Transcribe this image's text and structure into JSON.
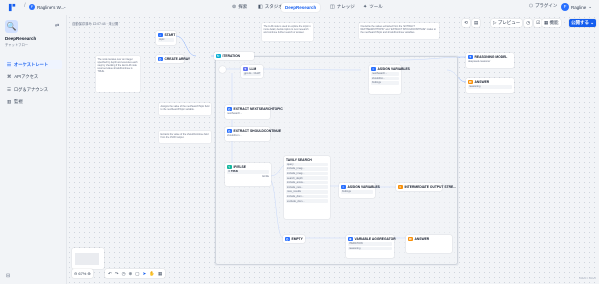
{
  "header": {
    "workspace_initial": "F",
    "workspace_name": "Ragline's W...",
    "nav": [
      {
        "label": "探索",
        "icon": "⊚"
      },
      {
        "label": "スタジオ",
        "icon": "◧"
      },
      {
        "label": "DeepResearch",
        "icon": ""
      },
      {
        "label": "ナレッジ",
        "icon": "◫"
      },
      {
        "label": "ツール",
        "icon": "✦"
      }
    ],
    "plugins": "プラグイン",
    "user_initial": "F",
    "user_name": "Ragline"
  },
  "sidebar": {
    "app_title": "DeepResearch",
    "app_type": "チャットフロー",
    "items": [
      {
        "label": "オーケストレート",
        "icon": "☷"
      },
      {
        "label": "APIアクセス",
        "icon": "⌘"
      },
      {
        "label": "ログ＆アナウンス",
        "icon": "☰"
      },
      {
        "label": "監視",
        "icon": "▥"
      }
    ]
  },
  "canvas": {
    "autosave": "自動保存済み 12:07:44 · 未公開",
    "preview": "プレビュー",
    "features": "機能",
    "publish": "公開する",
    "zoom": "67%",
    "hint": "Ctrl+C / Ctrl+V"
  },
  "nodes": {
    "start": {
      "title": "START",
      "row": "topic"
    },
    "create_array": {
      "title": "CREATE ARRAY"
    },
    "iteration": {
      "title": "ITERATION"
    },
    "llm": {
      "title": "LLM",
      "row": "gpt-4o · CHAT"
    },
    "assign1": {
      "title": "ASSIGN VARIABLES",
      "rows": [
        "nextSearch...",
        "shouldCo...",
        "findings"
      ]
    },
    "extract_next": {
      "title": "EXTRACT NEXTSEARCHTOPIC",
      "row": "nextSearch..."
    },
    "extract_should": {
      "title": "EXTRACT SHOULDCONTINUE",
      "row": "shouldCon..."
    },
    "ifelse": {
      "title": "IF/ELSE",
      "row_if": "IF",
      "row_val": "TRUE",
      "row_else": "ELSE"
    },
    "tavily": {
      "title": "TAVILY SEARCH",
      "rows": [
        "query",
        "include_imag...",
        "include_imag...",
        "search_depth",
        "include_answ...",
        "include_raw...",
        "max_results",
        "include_dom...",
        "exclude_dom..."
      ]
    },
    "assign2": {
      "title": "ASSIGN VARIABLES",
      "row": "findings"
    },
    "intermediate": {
      "title": "INTERMEDIATE OUTPUT STRE..."
    },
    "empty": {
      "title": "EMPTY"
    },
    "var_agg": {
      "title": "VARIABLE AGGREGATOR",
      "rows": [
        "ITERATION",
        "reasoning"
      ]
    },
    "answer": {
      "title": "ANSWER"
    },
    "reasoning": {
      "title": "REASONING MODEL",
      "row": "deepseek-reasoner"
    },
    "answer2": {
      "title": "ANSWER",
      "row": "reasoning"
    }
  },
  "notes": {
    "n1": "The node iterates over an integer specified by depth and executes each step by checking if the last LLM node returned value shouldContinue is TRUE.",
    "n2": "The LLM node is used to explore the topic in more detail, decide topics to next research and continue further search or answer.",
    "n3": "Overwrite the values extracted from the “EXTRACT NEXTSEARCHTOPIC” and “EXTRACT SHOULDCONTINUE” nodes to the nextSearchTopic and shouldContinue variables.",
    "n4": "Assigns the value of the nextSearchTopic field to the nextSearchTopic variable.",
    "n5": "Extracts the value of the shouldContinue field from the JSON output."
  }
}
